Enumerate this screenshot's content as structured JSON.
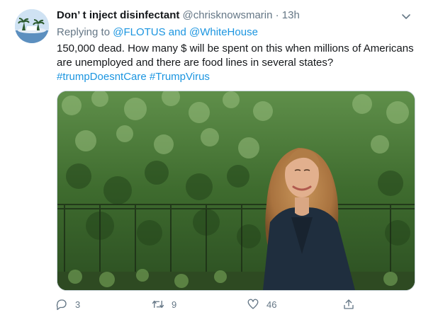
{
  "tweet": {
    "display_name": "Don’ t inject disinfectant",
    "handle": "@chrisknowsmarin",
    "separator": "·",
    "time": "13h",
    "replying_to_prefix": "Replying to",
    "replying_to_links": "@FLOTUS and @WhiteHouse",
    "text": "150,000 dead. How many $ will be spent on this when millions of Americans are unemployed and there are food lines in several states?",
    "hashtags": "#trumpDoesntCare #TrumpVirus"
  },
  "actions": {
    "reply_count": "3",
    "retweet_count": "9",
    "like_count": "46"
  },
  "icons": {
    "caret": "chevron-down-icon",
    "reply": "reply-icon",
    "retweet": "retweet-icon",
    "like": "heart-icon",
    "share": "share-icon"
  },
  "colors": {
    "link": "#1b95e0",
    "secondary_text": "#657786",
    "primary_text": "#14171a"
  }
}
